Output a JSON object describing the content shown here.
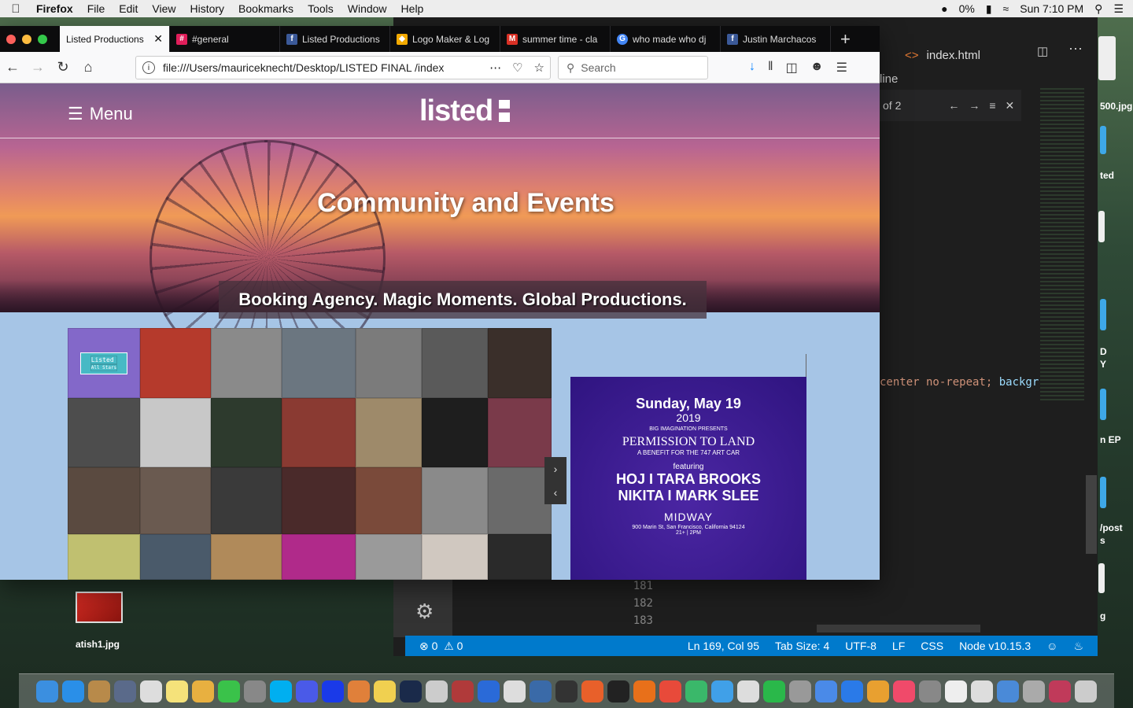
{
  "menubar": {
    "app_name": "Firefox",
    "items": [
      "File",
      "Edit",
      "View",
      "History",
      "Bookmarks",
      "Tools",
      "Window",
      "Help"
    ],
    "battery": "0%",
    "clock": "Sun 7:10 PM"
  },
  "browser": {
    "tabs": [
      {
        "title": "Listed Productions",
        "active": true,
        "icon": "listed-favicon",
        "color": "#f9f9fa"
      },
      {
        "title": "#general",
        "active": false,
        "icon": "slack-icon",
        "color": "#e01e5a"
      },
      {
        "title": "Listed Productions",
        "active": false,
        "icon": "facebook-icon",
        "color": "#3b5998"
      },
      {
        "title": "Logo Maker & Log",
        "active": false,
        "icon": "logo-maker-icon",
        "color": "#f2a900"
      },
      {
        "title": "summer time - cla",
        "active": false,
        "icon": "gmail-icon",
        "color": "#d93025"
      },
      {
        "title": "who made who dj",
        "active": false,
        "icon": "google-icon",
        "color": "#4285f4"
      },
      {
        "title": "Justin Marchacos",
        "active": false,
        "icon": "facebook-icon",
        "color": "#3b5998"
      }
    ],
    "url": "file:///Users/mauriceknecht/Desktop/LISTED FINAL /index",
    "search_placeholder": "Search"
  },
  "page": {
    "menu_label": "Menu",
    "logo_text": "listed",
    "hero_title": "Community and Events",
    "tagline": "Booking Agency. Magic Moments. Global Productions.",
    "allstars_badge": [
      "Listed",
      "All Stars"
    ],
    "poster": {
      "date": "Sunday, May 19",
      "year": "2019",
      "presenter": "BIG IMAGINATION PRESENTS",
      "title": "PERMISSION TO LAND",
      "subtitle": "A BENEFIT FOR THE 747 ART CAR",
      "featuring": "featuring",
      "artists_1": "HOJ I TARA BROOKS",
      "artists_2": "NIKITA I MARK SLEE",
      "venue": "MIDWAY",
      "address": "900 Marin St, San Francisco, California 94124",
      "time": "21+ | 2PM"
    },
    "grid_colors": [
      "#8368c9",
      "#b53a2c",
      "#8a8a8a",
      "#6b7680",
      "#7b7b7b",
      "#5a5a5a",
      "#3a2f2a",
      "#4d4d4d",
      "#c8c8c8",
      "#2d3a2d",
      "#8a3a32",
      "#9e8a6a",
      "#1e1e1e",
      "#7a3a4a",
      "#5a4a40",
      "#6a5a50",
      "#3a3a3a",
      "#4a2a2a",
      "#7a4a3a",
      "#8a8a8a",
      "#6a6a6a",
      "#c0c070",
      "#4a5a6a",
      "#b08a5a",
      "#b02a8a",
      "#9a9a9a",
      "#d0c8c0",
      "#2a2a2a"
    ]
  },
  "editor": {
    "tab_title": "index.html",
    "find_result": "of 2",
    "partial_word": "line",
    "code_snippet": [
      "center no-repeat; ",
      "backgr"
    ],
    "line_numbers": [
      "181",
      "182",
      "183"
    ],
    "status": {
      "errors": "0",
      "warnings": "0",
      "position": "Ln 169, Col 95",
      "tab_size": "Tab Size: 4",
      "encoding": "UTF-8",
      "eol": "LF",
      "language": "CSS",
      "runtime": "Node v10.15.3"
    }
  },
  "desktop": {
    "file_label": "atish1.jpg",
    "side_labels": [
      "ted",
      "D",
      "Y",
      "n EP",
      "/post",
      "s",
      "g",
      "500.jpg"
    ]
  }
}
